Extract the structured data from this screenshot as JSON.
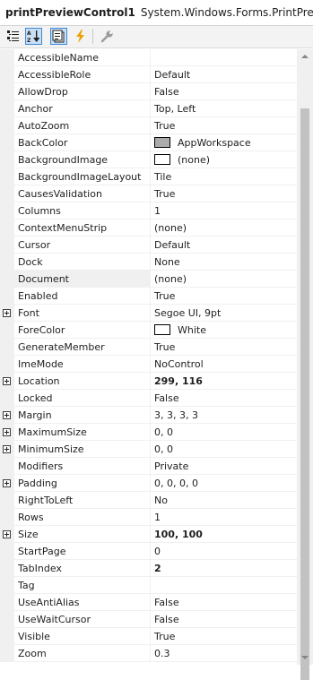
{
  "header": {
    "control_name": "printPreviewControl1",
    "control_type": "System.Windows.Forms.PrintPreviewC"
  },
  "toolbar": {
    "buttons": [
      {
        "name": "categorized-view-icon",
        "active": false
      },
      {
        "name": "alphabetical-view-icon",
        "active": true
      },
      {
        "name": "properties-view-icon",
        "active": true
      },
      {
        "name": "events-icon",
        "active": false
      },
      {
        "name": "property-pages-icon",
        "active": false
      }
    ]
  },
  "colors": {
    "app_workspace": "#ababab",
    "white": "#ffffff",
    "lightning": "#e8a400"
  },
  "properties": [
    {
      "name": "AccessibleName",
      "value": ""
    },
    {
      "name": "AccessibleRole",
      "value": "Default"
    },
    {
      "name": "AllowDrop",
      "value": "False"
    },
    {
      "name": "Anchor",
      "value": "Top, Left"
    },
    {
      "name": "AutoZoom",
      "value": "True"
    },
    {
      "name": "BackColor",
      "value": "AppWorkspace",
      "swatch": "#ababab"
    },
    {
      "name": "BackgroundImage",
      "value": "(none)",
      "swatch": "#ffffff"
    },
    {
      "name": "BackgroundImageLayout",
      "value": "Tile"
    },
    {
      "name": "CausesValidation",
      "value": "True"
    },
    {
      "name": "Columns",
      "value": "1"
    },
    {
      "name": "ContextMenuStrip",
      "value": "(none)"
    },
    {
      "name": "Cursor",
      "value": "Default"
    },
    {
      "name": "Dock",
      "value": "None"
    },
    {
      "name": "Document",
      "value": "(none)",
      "selected": true
    },
    {
      "name": "Enabled",
      "value": "True"
    },
    {
      "name": "Font",
      "value": "Segoe UI, 9pt",
      "expandable": true
    },
    {
      "name": "ForeColor",
      "value": "White",
      "swatch": "#ffffff"
    },
    {
      "name": "GenerateMember",
      "value": "True"
    },
    {
      "name": "ImeMode",
      "value": "NoControl"
    },
    {
      "name": "Location",
      "value": "299, 116",
      "expandable": true,
      "bold": true
    },
    {
      "name": "Locked",
      "value": "False"
    },
    {
      "name": "Margin",
      "value": "3, 3, 3, 3",
      "expandable": true
    },
    {
      "name": "MaximumSize",
      "value": "0, 0",
      "expandable": true
    },
    {
      "name": "MinimumSize",
      "value": "0, 0",
      "expandable": true
    },
    {
      "name": "Modifiers",
      "value": "Private"
    },
    {
      "name": "Padding",
      "value": "0, 0, 0, 0",
      "expandable": true
    },
    {
      "name": "RightToLeft",
      "value": "No"
    },
    {
      "name": "Rows",
      "value": "1"
    },
    {
      "name": "Size",
      "value": "100, 100",
      "expandable": true,
      "bold": true
    },
    {
      "name": "StartPage",
      "value": "0"
    },
    {
      "name": "TabIndex",
      "value": "2",
      "bold": true
    },
    {
      "name": "Tag",
      "value": ""
    },
    {
      "name": "UseAntiAlias",
      "value": "False"
    },
    {
      "name": "UseWaitCursor",
      "value": "False"
    },
    {
      "name": "Visible",
      "value": "True"
    },
    {
      "name": "Zoom",
      "value": "0.3"
    }
  ]
}
